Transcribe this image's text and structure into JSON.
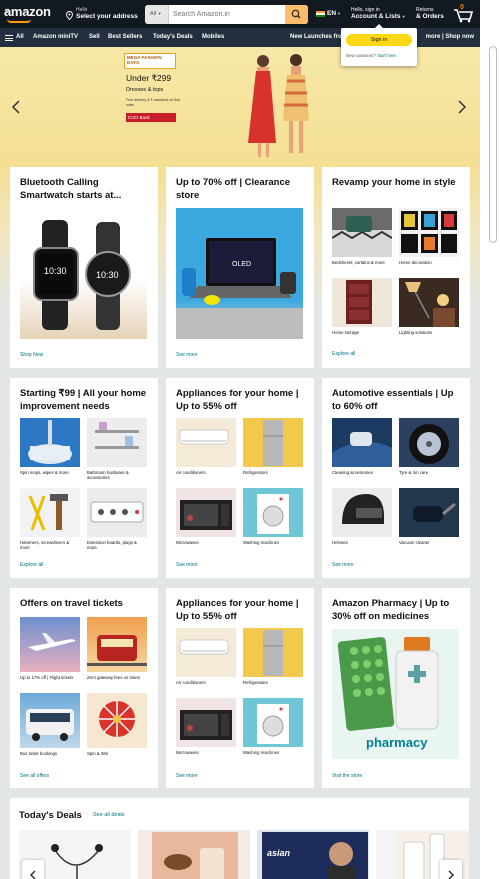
{
  "nav": {
    "logo_text": "amazon",
    "logo_suffix": ".in",
    "address_line1": "Hello",
    "address_line2": "Select your address",
    "search_category": "All",
    "search_placeholder": "Search Amazon.in",
    "language": "EN",
    "account_line1": "Hello, sign in",
    "account_line2": "Account & Lists",
    "returns_line1": "Returns",
    "returns_line2": "& Orders",
    "cart_count": "0"
  },
  "subnav": {
    "all": "All",
    "items": [
      "Amazon miniTV",
      "Sell",
      "Best Sellers",
      "Today's Deals",
      "Mobiles"
    ],
    "right_left": "New Launches fro",
    "right_text": "more | Shop now"
  },
  "signin_popup": {
    "button": "Sign in",
    "new_customer": "New customer?",
    "start_here": "Start here."
  },
  "hero": {
    "promo_tag": "MEGA FASHION DAYS",
    "promo_under": "Under ₹299",
    "promo_dress": "Dresses & tops",
    "promo_free": "Free delivery & ₹ cashback on first order",
    "promo_bank": "ICICI Bank"
  },
  "cards": [
    {
      "title": "Bluetooth Calling Smartwatch starts at...",
      "link": "Shop Now"
    },
    {
      "title": "Up to 70% off | Clearance store",
      "link": "See more"
    },
    {
      "title": "Revamp your home in style",
      "link": "Explore all",
      "tiles": [
        "Bedsheets, curtains & more",
        "Home decoration",
        "Home storage",
        "Lighting solutions"
      ]
    },
    {
      "title": "Starting ₹99 | All your home improvement needs",
      "link": "Explore all",
      "tiles": [
        "Spin mops, wipes & more",
        "Bathroom hardware & accessories",
        "Hammers, screwdrivers & more",
        "Extension boards, plugs & more"
      ]
    },
    {
      "title": "Appliances for your home | Up to 55% off",
      "link": "See more",
      "tiles": [
        "Air conditioners",
        "Refrigerators",
        "Microwaves",
        "Washing machines"
      ]
    },
    {
      "title": "Automotive essentials | Up to 60% off",
      "link": "See more",
      "tiles": [
        "Cleaning accessories",
        "Tyre & rim care",
        "Helmets",
        "Vacuum cleaner"
      ]
    },
    {
      "title": "Offers on travel tickets",
      "link": "See all offers",
      "tiles": [
        "Up to 17% off | Flight tickets",
        "Zero gateway fees on trains",
        "Bus ticket bookings",
        "Spin & Win"
      ]
    },
    {
      "title": "Appliances for your home | Up to 55% off",
      "link": "See more",
      "tiles": [
        "Air conditioners",
        "Refrigerators",
        "Microwaves",
        "Washing machines"
      ]
    },
    {
      "title": "Amazon Pharmacy | Up to 30% off on medicines",
      "link": "Visit the store",
      "image_text": "pharmacy"
    }
  ],
  "deals": {
    "title": "Today's Deals",
    "link": "See all deals",
    "brand_text": "asian"
  },
  "colors": {
    "nav_bg": "#131921",
    "subnav_bg": "#232f3e",
    "accent_orange": "#febd69",
    "signin_yellow": "#ffd814",
    "link_teal": "#007185"
  }
}
